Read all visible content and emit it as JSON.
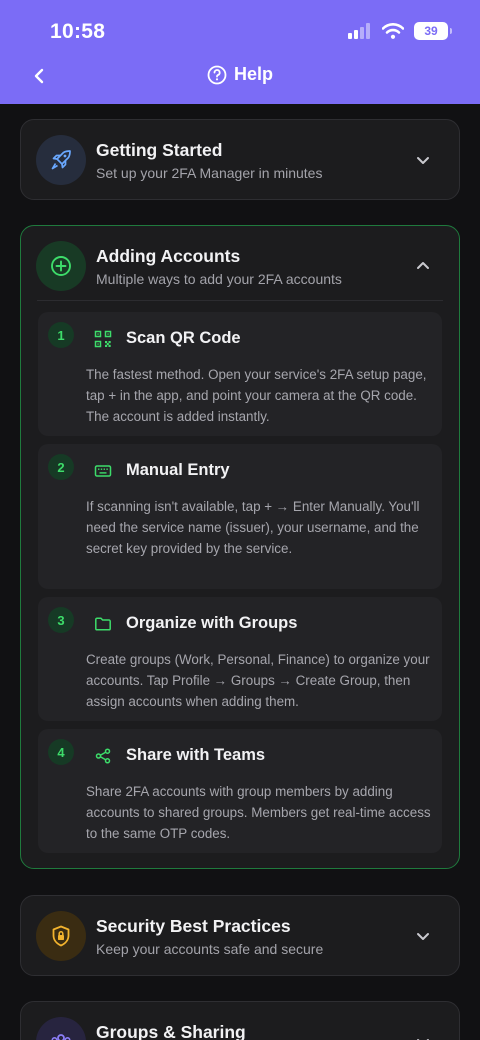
{
  "status_bar": {
    "time": "10:58",
    "battery": "39"
  },
  "nav": {
    "title": "Help"
  },
  "sections": {
    "getting_started": {
      "title": "Getting Started",
      "subtitle": "Set up your 2FA Manager in minutes"
    },
    "adding_accounts": {
      "title": "Adding Accounts",
      "subtitle": "Multiple ways to add your 2FA accounts",
      "steps": [
        {
          "number": "1",
          "title": "Scan QR Code",
          "body": "The fastest method. Open your service's 2FA setup page, tap + in the app, and point your camera at the QR code. The account is added instantly."
        },
        {
          "number": "2",
          "title": "Manual Entry",
          "body": "If scanning isn't available, tap + → Enter Manually. You'll need the service name (issuer), your username, and the secret key provided by the service."
        },
        {
          "number": "3",
          "title": "Organize with Groups",
          "body": "Create groups (Work, Personal, Finance) to organize your accounts. Tap Profile → Groups → Create Group, then assign accounts when adding them."
        },
        {
          "number": "4",
          "title": "Share with Teams",
          "body": "Share 2FA accounts with group members by adding accounts to shared groups. Members get real-time access to the same OTP codes."
        }
      ]
    },
    "security": {
      "title": "Security Best Practices",
      "subtitle": "Keep your accounts safe and secure"
    },
    "groups_sharing": {
      "title": "Groups & Sharing"
    }
  },
  "icons": {
    "back": "chevron-left-icon",
    "help": "question-circle-icon",
    "getting_started": "rocket-icon",
    "adding_accounts": "plus-circle-icon",
    "step_1": "qr-code-icon",
    "step_2": "keyboard-icon",
    "step_3": "folder-icon",
    "step_4": "share-icon",
    "security": "shield-lock-icon",
    "groups_sharing": "people-icon"
  },
  "colors": {
    "header": "#7b6cf6",
    "background": "#111113",
    "card": "#1c1c1e",
    "accent_green": "#3ddc6a",
    "open_border": "#1f7a3d",
    "rocket_accent": "#6aa8ff",
    "shield_accent": "#f2b32e",
    "groups_accent": "#7b6cf6"
  }
}
